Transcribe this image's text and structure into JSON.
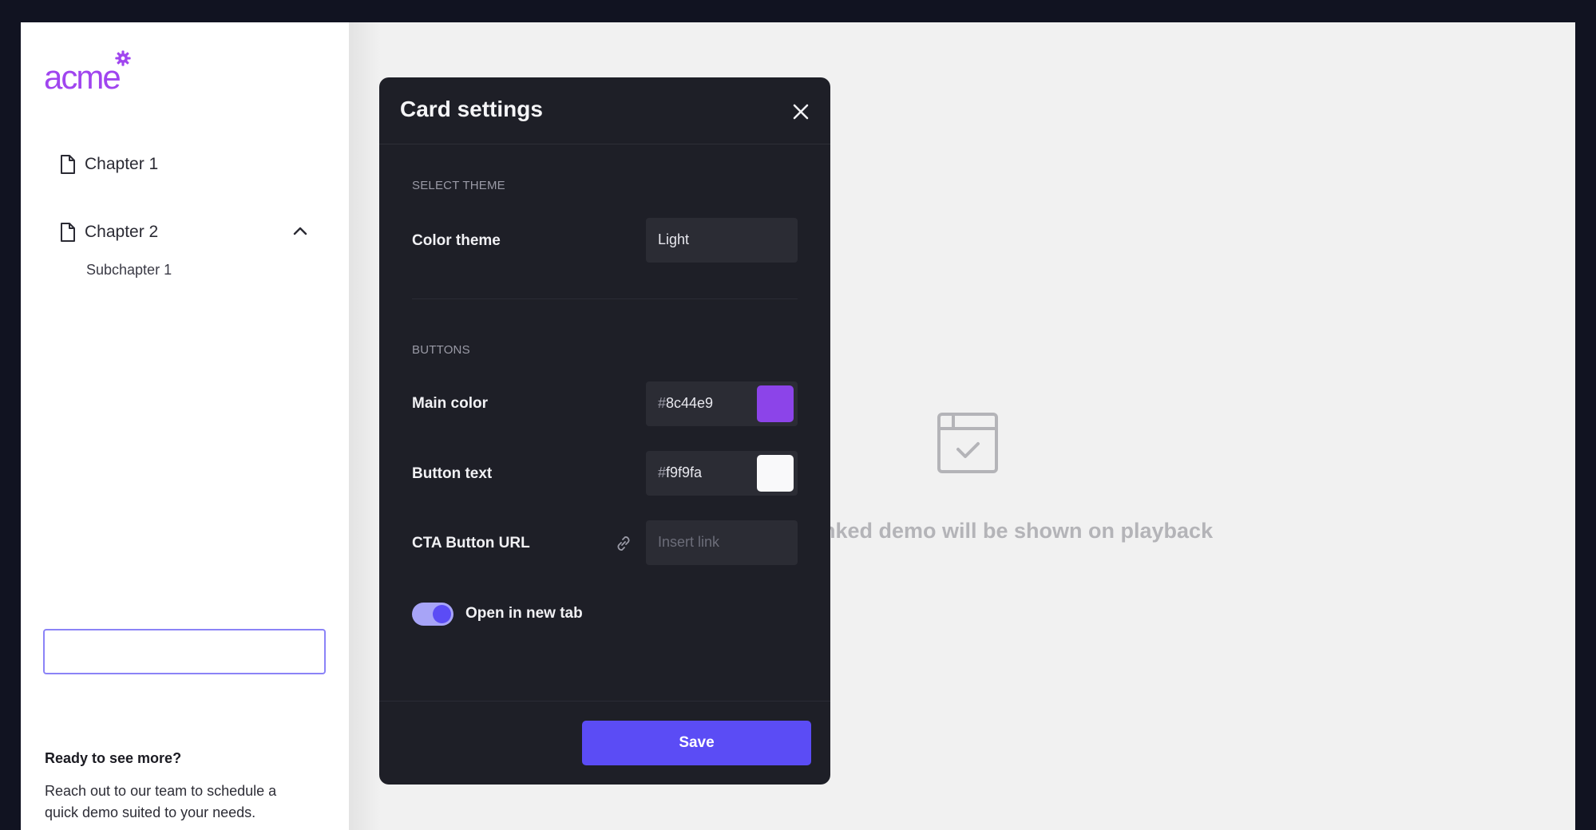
{
  "sidebar": {
    "logo_text": "acme",
    "items": [
      {
        "label": "Chapter 1",
        "icon": "document-icon"
      },
      {
        "label": "Chapter 2",
        "icon": "document-icon",
        "expanded": true,
        "children": [
          {
            "label": "Subchapter 1"
          }
        ]
      }
    ],
    "cta": {
      "title": "Ready to see more?",
      "text": "Reach out to our team to schedule a quick demo suited to your needs."
    }
  },
  "main": {
    "placeholder_text": "Linked demo will be shown on playback",
    "placeholder_icon": "browser-check-icon"
  },
  "modal": {
    "title": "Card settings",
    "theme_section": {
      "label": "SELECT THEME",
      "color_theme_label": "Color theme",
      "color_theme_value": "Light"
    },
    "buttons_section": {
      "label": "BUTTONS",
      "main_color_label": "Main color",
      "main_color_hash": "#",
      "main_color_value": "8c44e9",
      "main_color_swatch": "#8c44e9",
      "button_text_label": "Button text",
      "button_text_hash": "#",
      "button_text_value": "f9f9fa",
      "button_text_swatch": "#f9f9fa",
      "cta_url_label": "CTA Button URL",
      "cta_url_placeholder": "Insert link",
      "open_new_tab_label": "Open in new tab",
      "open_new_tab_enabled": true
    },
    "save_label": "Save"
  },
  "colors": {
    "accent": "#5b4cf5",
    "brand": "#a045ef",
    "modal_bg": "#1e1f27"
  }
}
